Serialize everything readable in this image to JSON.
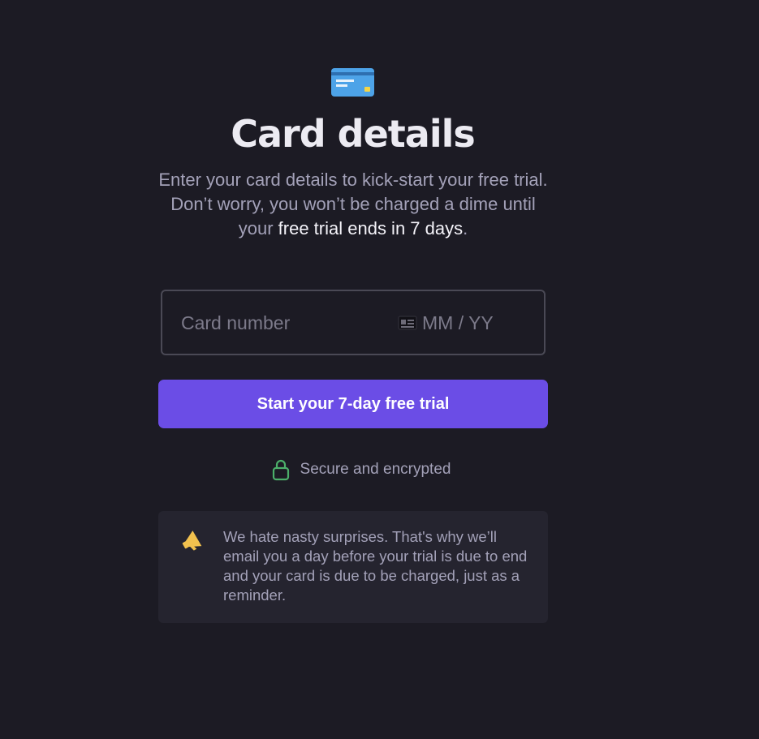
{
  "header": {
    "icon": "credit-card-icon",
    "title": "Card details",
    "subtitle_part1": "Enter your card details to kick-start your free trial. Don’t worry, you won’t be charged a dime until your ",
    "subtitle_highlight": "free trial ends in 7 days",
    "subtitle_part2": "."
  },
  "card_input": {
    "card_number_placeholder": "Card number",
    "expiry_placeholder": "MM / YY",
    "icon": "id-card-icon"
  },
  "cta": {
    "label": "Start your 7-day free trial"
  },
  "secure": {
    "icon": "lock-icon",
    "text": "Secure and encrypted"
  },
  "notice": {
    "icon": "megaphone-icon",
    "text": "We hate nasty surprises. That's why we’ll email you a day before your trial is due to end and your card is due to be charged, just as a reminder."
  },
  "colors": {
    "background": "#1c1b24",
    "accent": "#6b4de6",
    "lock": "#4caf6a",
    "megaphone": "#f2c14e",
    "card_icon": "#4da3e8"
  }
}
